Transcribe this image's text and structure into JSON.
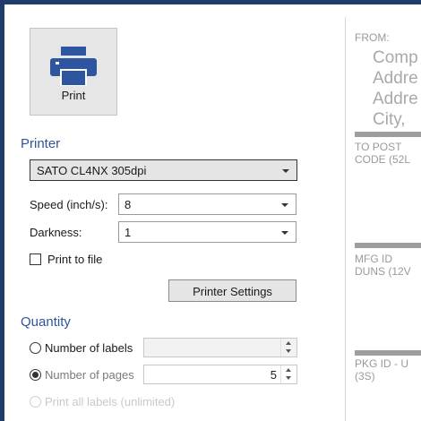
{
  "print_button": {
    "label": "Print",
    "icon": "printer-icon"
  },
  "printer_section": {
    "title": "Printer",
    "selected_printer": "SATO CL4NX 305dpi",
    "speed_label": "Speed (inch/s):",
    "speed_value": "8",
    "darkness_label": "Darkness:",
    "darkness_value": "1",
    "print_to_file_label": "Print to file",
    "print_to_file_checked": false,
    "printer_settings_label": "Printer Settings"
  },
  "quantity_section": {
    "title": "Quantity",
    "number_of_labels_label": "Number of labels",
    "number_of_labels_value": "",
    "number_of_pages_label": "Number of pages",
    "number_of_pages_value": "5",
    "print_all_label": "Print all labels (unlimited)",
    "selected": "number_of_pages"
  },
  "preview": {
    "from_label": "FROM:",
    "from_lines": [
      "Comp",
      "Addre",
      "Addre",
      "City,"
    ],
    "to_post_line1": "TO POST",
    "to_post_line2": "CODE (52L",
    "mfg_line1": "MFG ID",
    "mfg_line2": "DUNS (12V",
    "pkg_line1": "PKG ID - U",
    "pkg_line2": "(3S)"
  },
  "colors": {
    "accent": "#2f5597",
    "outer_background": "#1f3d6b",
    "printer_icon": "#2e55a0"
  }
}
